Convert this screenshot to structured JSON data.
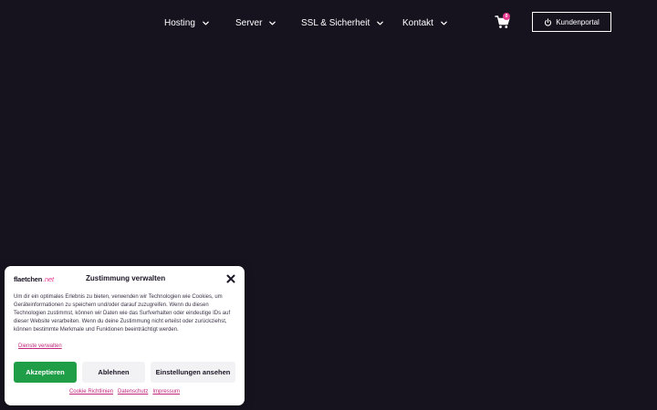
{
  "nav": {
    "items": [
      {
        "label": "Hosting"
      },
      {
        "label": "Server"
      },
      {
        "label": "SSL & Sicherheit"
      },
      {
        "label": "Kontakt"
      }
    ],
    "cart_count": "0",
    "portal_label": "Kundenportal"
  },
  "consent": {
    "logo_text": "flaetchen",
    "logo_tld": ".net",
    "title": "Zustimmung verwalten",
    "body": "Um dir ein optimales Erlebnis zu bieten, verwenden wir Technologien wie Cookies, um Geräteinformationen zu speichern und/oder darauf zuzugreifen. Wenn du diesen Technologien zustimmst, können wir Daten wie das Surfverhalten oder eindeutige IDs auf dieser Website verarbeiten. Wenn du deine Zustimmung nicht erteilst oder zurückziehst, können bestimmte Merkmale und Funktionen beeinträchtigt werden.",
    "manage_services": "Dienste verwalten",
    "accept": "Akzeptieren",
    "decline": "Ablehnen",
    "settings": "Einstellungen ansehen",
    "links": {
      "cookie": "Cookie Richtlinien",
      "privacy": "Datenschutz",
      "imprint": "Impressum"
    }
  },
  "colors": {
    "background": "#16131f",
    "accent_pink": "#e8378f",
    "accept_green": "#1f9d47"
  },
  "icons": {
    "chevron": "chevron-down-icon",
    "cart": "shopping-cart-icon",
    "power": "power-icon",
    "close": "close-icon"
  }
}
